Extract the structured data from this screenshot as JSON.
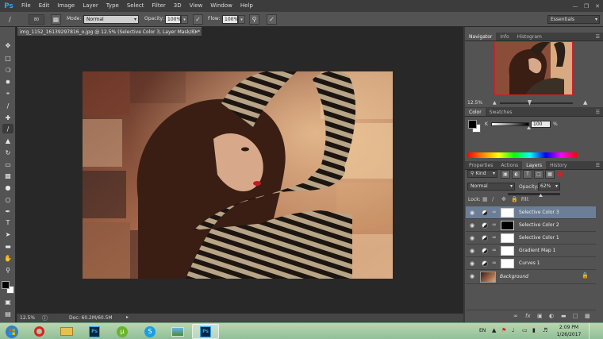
{
  "app": {
    "logo": "Ps"
  },
  "menu": [
    "File",
    "Edit",
    "Image",
    "Layer",
    "Type",
    "Select",
    "Filter",
    "3D",
    "View",
    "Window",
    "Help"
  ],
  "options": {
    "brush_size": "80",
    "mode_label": "Mode:",
    "mode_value": "Normal",
    "opacity_label": "Opacity:",
    "opacity_value": "100%",
    "flow_label": "Flow:",
    "flow_value": "100%",
    "workspace": "Essentials"
  },
  "document": {
    "tab_title": "img_1152_16139297816_o.jpg @ 12.5% (Selective Color 3, Layer Mask/8) *",
    "zoom": "12.5%",
    "doc_size": "Doc: 60.2M/60.5M"
  },
  "navigator": {
    "tabs": [
      "Navigator",
      "Info",
      "Histogram"
    ],
    "zoom": "12.5%"
  },
  "color_panel": {
    "tabs": [
      "Color",
      "Swatches"
    ],
    "channel_label": "K",
    "value": "100",
    "unit": "%",
    "fg_color": "#000000",
    "bg_color": "#ffffff"
  },
  "layers_panel": {
    "tabs": [
      "Properties",
      "Actions",
      "Layers",
      "History"
    ],
    "kind_label": "Kind",
    "blend_mode": "Normal",
    "opacity_label": "Opacity:",
    "opacity_value": "62%",
    "lock_label": "Lock:",
    "fill_label": "Fill:",
    "layers": [
      {
        "name": "Selective Color 3",
        "selected": true,
        "mask": "white"
      },
      {
        "name": "Selective Color 2",
        "selected": false,
        "mask": "black"
      },
      {
        "name": "Selective Color 1",
        "selected": false,
        "mask": "white"
      },
      {
        "name": "Gradient Map 1",
        "selected": false,
        "mask": "white"
      },
      {
        "name": "Curves 1",
        "selected": false,
        "mask": "white"
      },
      {
        "name": "Background",
        "selected": false,
        "mask": "photo"
      }
    ]
  },
  "taskbar": {
    "language": "EN",
    "time": "2:09 PM",
    "date": "1/26/2017",
    "accent": "#91bf98"
  }
}
